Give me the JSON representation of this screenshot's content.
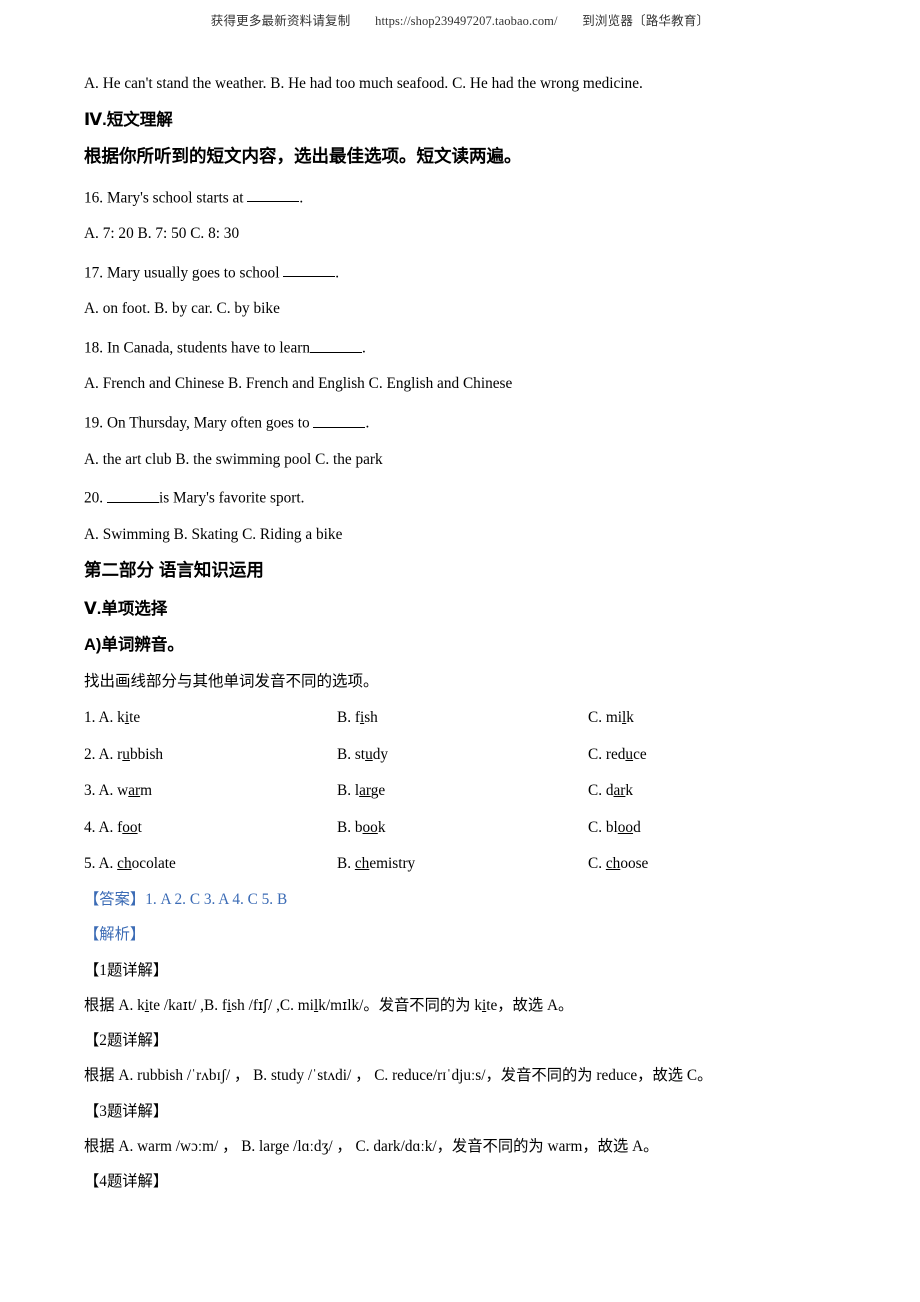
{
  "watermark": {
    "prefix": "获得更多最新资料请复制",
    "url": "https://shop239497207.taobao.com/",
    "suffix": "到浏览器〔路华教育〕"
  },
  "top_options_line": "A. He can't stand the weather.      B. He had too much seafood.      C. He had the wrong medicine.",
  "section4": {
    "heading": "Ⅳ.短文理解",
    "instruction": "根据你所听到的短文内容，选出最佳选项。短文读两遍。",
    "questions": [
      {
        "number": "16.",
        "stem_before": "Mary's school starts at",
        "stem_after": ".",
        "options": "A. 7: 20      B. 7: 50      C. 8: 30"
      },
      {
        "number": "17.",
        "stem_before": "Mary usually goes to school",
        "stem_after": ".",
        "options": "A. on foot.      B. by car.      C. by bike"
      },
      {
        "number": "18.",
        "stem_before": "In Canada, students have to learn",
        "stem_after": ".",
        "options": "A. French and Chinese      B. French and English      C. English and Chinese"
      },
      {
        "number": "19.",
        "stem_before": "On Thursday, Mary often goes to",
        "stem_after": ".",
        "options": "A. the art club      B. the swimming pool      C. the park"
      },
      {
        "number": "20.",
        "stem_before": "",
        "stem_after": "is Mary's favorite sport.",
        "options": "A. Swimming      B. Skating      C. Riding a bike"
      }
    ]
  },
  "part2": {
    "heading": "第二部分   语言知识运用",
    "section5_heading": "Ⅴ.单项选择",
    "subsection_a_heading": "A)单词辨音。",
    "instruction": "找出画线部分与其他单词发音不同的选项。",
    "items": [
      {
        "number": "1.",
        "a_label": "A.",
        "a_pre": "k",
        "a_ul": "i",
        "a_post": "te",
        "b_label": "B.",
        "b_pre": "f",
        "b_ul": "i",
        "b_post": "sh",
        "c_label": "C.",
        "c_pre": "mi",
        "c_ul": "l",
        "c_post": "k"
      },
      {
        "number": "2.",
        "a_label": "A.",
        "a_pre": "r",
        "a_ul": "u",
        "a_post": "bbish",
        "b_label": "B.",
        "b_pre": "st",
        "b_ul": "u",
        "b_post": "dy",
        "c_label": "C.",
        "c_pre": "red",
        "c_ul": "u",
        "c_post": "ce"
      },
      {
        "number": "3.",
        "a_label": "A.",
        "a_pre": "w",
        "a_ul": "ar",
        "a_post": "m",
        "b_label": "B.",
        "b_pre": "l",
        "b_ul": "ar",
        "b_post": "ge",
        "c_label": "C.",
        "c_pre": "d",
        "c_ul": "ar",
        "c_post": "k"
      },
      {
        "number": "4.",
        "a_label": "A.",
        "a_pre": "f",
        "a_ul": "oo",
        "a_post": "t",
        "b_label": "B.",
        "b_pre": "b",
        "b_ul": "oo",
        "b_post": "k",
        "c_label": "C.",
        "c_pre": "bl",
        "c_ul": "oo",
        "c_post": "d"
      },
      {
        "number": "5.",
        "a_label": "A.",
        "a_pre": "",
        "a_ul": "ch",
        "a_post": "ocolate",
        "b_label": "B.",
        "b_pre": "",
        "b_ul": "ch",
        "b_post": "emistry",
        "c_label": "C.",
        "c_pre": "",
        "c_ul": "ch",
        "c_post": "oose"
      }
    ]
  },
  "answer_key": {
    "label": "【答案】",
    "answers": "1. A     2. C     3. A     4. C     5. B"
  },
  "analysis_label": "【解析】",
  "explanations": [
    {
      "heading": "【1题详解】",
      "prefix": "根据 A. k",
      "w1_ul": "i",
      "w1_post": "te /ka",
      "ipa1": "ɪ",
      "mid1": "t/ ,B. f",
      "w2_ul": "i",
      "w2_post": "sh /f",
      "ipa2": "ɪʃ",
      "mid2": "/ ,C. mi",
      "w3_ul": "l",
      "w3_post": "k/m",
      "ipa3": "ɪ",
      "tail": "lk/。发音不同的为 k",
      "ans_ul": "i",
      "ans_post": "te，故选 A。"
    },
    {
      "heading": "【2题详解】",
      "full": "根据 A. rubbish /ˈrʌbɪʃ/ ， B. study /ˈstʌdi/ ， C. reduce/rɪˈdjuːs/，发音不同的为 reduce，故选 C。"
    },
    {
      "heading": "【3题详解】",
      "full": "根据 A. warm     /wɔːm/ ， B. large /lɑːdʒ/ ， C. dark/dɑːk/，发音不同的为 warm，故选 A。"
    },
    {
      "heading": "【4题详解】",
      "full": ""
    }
  ]
}
